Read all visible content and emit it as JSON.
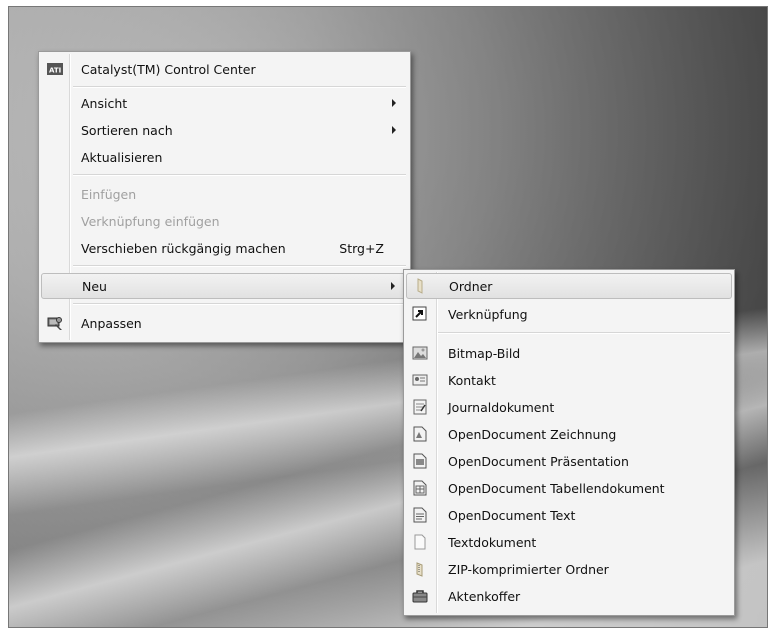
{
  "context_menu": {
    "items": [
      {
        "label": "Catalyst(TM) Control Center",
        "icon": "ati-logo-icon"
      },
      {
        "label": "Ansicht",
        "submenu": true
      },
      {
        "label": "Sortieren nach",
        "submenu": true
      },
      {
        "label": "Aktualisieren"
      },
      {
        "label": "Einfügen",
        "disabled": true
      },
      {
        "label": "Verknüpfung einfügen",
        "disabled": true
      },
      {
        "label": "Verschieben rückgängig machen",
        "shortcut": "Strg+Z"
      },
      {
        "label": "Neu",
        "submenu": true,
        "highlighted": true
      },
      {
        "label": "Anpassen",
        "icon": "personalize-icon"
      }
    ]
  },
  "new_submenu": {
    "items": [
      {
        "label": "Ordner",
        "icon": "folder-icon",
        "highlighted": true
      },
      {
        "label": "Verknüpfung",
        "icon": "shortcut-icon"
      },
      {
        "label": "Bitmap-Bild",
        "icon": "bitmap-image-icon"
      },
      {
        "label": "Kontakt",
        "icon": "contact-icon"
      },
      {
        "label": "Journaldokument",
        "icon": "journal-document-icon"
      },
      {
        "label": "OpenDocument Zeichnung",
        "icon": "opendocument-drawing-icon"
      },
      {
        "label": "OpenDocument Präsentation",
        "icon": "opendocument-presentation-icon"
      },
      {
        "label": "OpenDocument Tabellendokument",
        "icon": "opendocument-spreadsheet-icon"
      },
      {
        "label": "OpenDocument Text",
        "icon": "opendocument-text-icon"
      },
      {
        "label": "Textdokument",
        "icon": "text-document-icon"
      },
      {
        "label": "ZIP-komprimierter Ordner",
        "icon": "zip-folder-icon"
      },
      {
        "label": "Aktenkoffer",
        "icon": "briefcase-icon"
      }
    ]
  },
  "colors": {
    "menu_bg": "#f4f4f4",
    "disabled_text": "#a0a0a0",
    "highlight": "#e6e6e6"
  }
}
